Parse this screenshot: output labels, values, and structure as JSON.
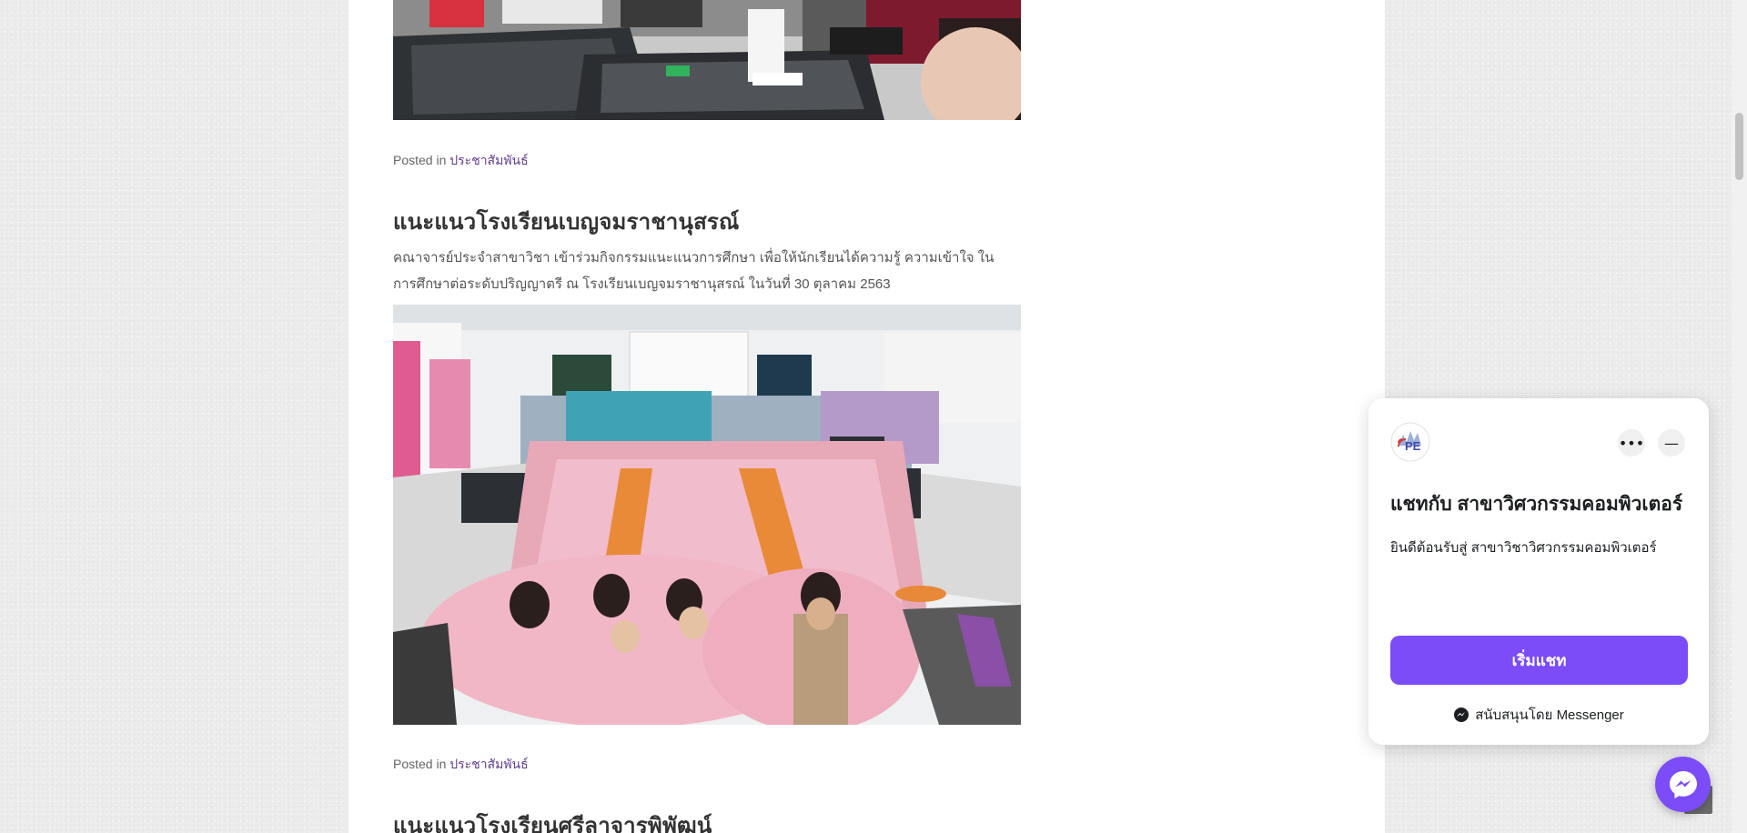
{
  "posts": [
    {
      "posted_label": "Posted in",
      "category": "ประชาสัมพันธ์"
    },
    {
      "title": "แนะแนวโรงเรียนเบญจมราชานุสรณ์",
      "excerpt": "คณาจารย์ประจำสาขาวิชา เข้าร่วมกิจกรรมแนะแนวการศึกษา เพื่อให้นักเรียนได้ความรู้ ความเข้าใจ ในการศึกษาต่อระดับปริญญาตรี ณ โรงเรียนเบญจมราชานุสรณ์ ในวันที่ 30 ตุลาคม 2563",
      "posted_label": "Posted in",
      "category": "ประชาสัมพันธ์"
    },
    {
      "title": "แนะแนวโรงเรียนศรีลาจารพิพัฒน์"
    }
  ],
  "chat": {
    "logo_text": "PE",
    "title": "แชทกับ สาขาวิศวกรรมคอมพิวเตอร์",
    "welcome": "ยินดีต้อนรับสู่ สาขาวิชาวิศวกรรมคอมพิวเตอร์",
    "start_label": "เริ่มแชท",
    "powered_by": "สนับสนุนโดย Messenger",
    "more_icon": "more-horizontal-icon",
    "minimize_icon": "minimize-icon",
    "accent": "#7b4cf8"
  },
  "colors": {
    "link": "#5f3f8c",
    "title": "#333333"
  }
}
